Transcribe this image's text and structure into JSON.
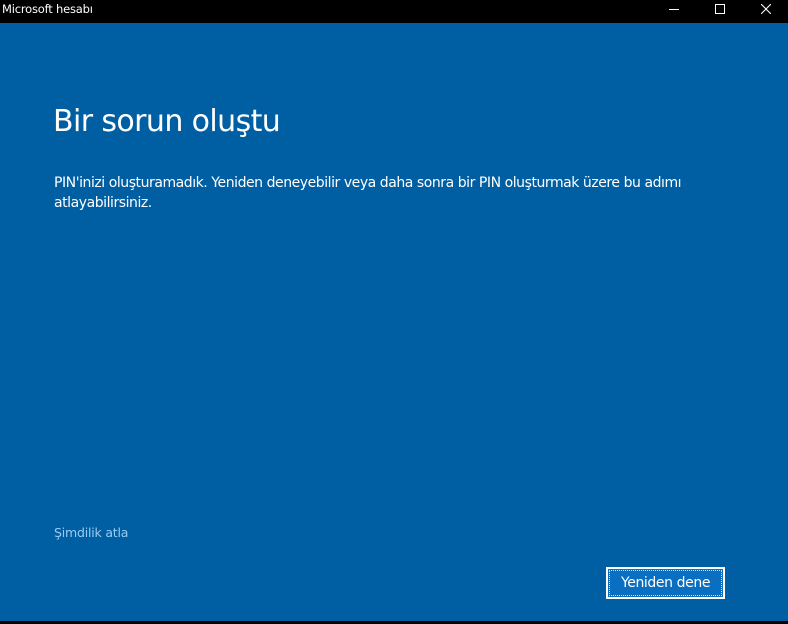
{
  "window": {
    "title": "Microsoft hesabı",
    "controls": {
      "minimize_icon": "minimize-icon",
      "maximize_icon": "maximize-icon",
      "close_icon": "close-icon"
    },
    "colors": {
      "titlebar": "#000000",
      "background": "#005ea3",
      "link": "#99ccf2",
      "button": "#0b6fc1"
    }
  },
  "dialog": {
    "heading": "Bir sorun oluştu",
    "message": "PIN'inizi oluşturamadık. Yeniden deneyebilir veya daha sonra bir PIN oluşturmak üzere bu adımı atlayabilirsiniz.",
    "skip_link": "Şimdilik atla",
    "retry_button": "Yeniden dene"
  }
}
